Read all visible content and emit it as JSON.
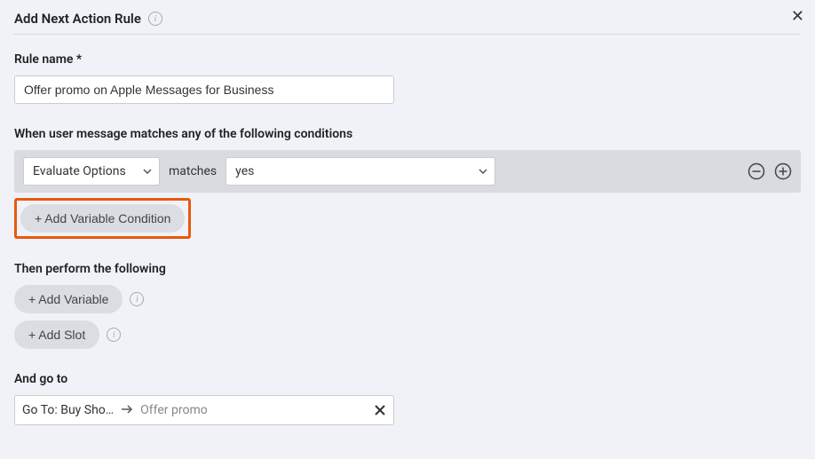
{
  "header": {
    "title": "Add Next Action Rule"
  },
  "ruleName": {
    "label": "Rule name *",
    "value": "Offer promo on Apple Messages for Business"
  },
  "conditions": {
    "label": "When user message matches any of the following conditions",
    "row": {
      "select1": "Evaluate Options",
      "operator": "matches",
      "select2": "yes"
    },
    "addVariableCondition": "+ Add Variable Condition"
  },
  "perform": {
    "label": "Then perform the following",
    "addVariable": "+ Add Variable",
    "addSlot": "+ Add Slot"
  },
  "goto": {
    "label": "And go to",
    "valuePrefix": "Go To: Buy Sho…",
    "placeholder": "Offer promo"
  }
}
